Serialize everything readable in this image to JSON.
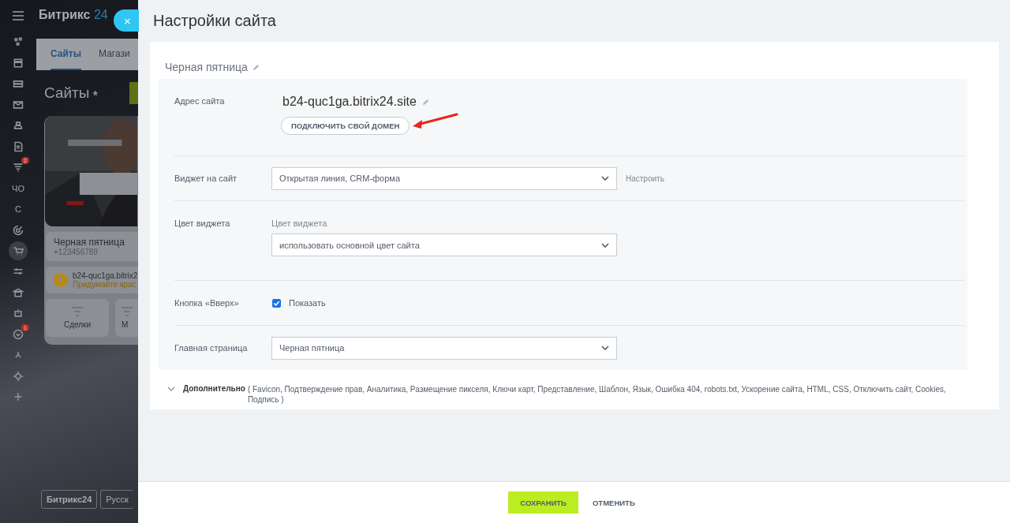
{
  "background_app": {
    "logo": {
      "name": "Битрикс",
      "accent": "24"
    },
    "nav": [
      {
        "kind": "icon"
      },
      {
        "kind": "icon"
      },
      {
        "kind": "icon"
      },
      {
        "kind": "icon"
      },
      {
        "kind": "icon"
      },
      {
        "kind": "icon"
      },
      {
        "kind": "icon",
        "badge": "2"
      },
      {
        "kind": "text",
        "label": "ЧО"
      },
      {
        "kind": "text",
        "label": "С"
      },
      {
        "kind": "icon"
      },
      {
        "kind": "icon",
        "selected": true
      },
      {
        "kind": "icon"
      },
      {
        "kind": "icon"
      },
      {
        "kind": "icon"
      },
      {
        "kind": "icon",
        "badge": "1"
      },
      {
        "kind": "icon"
      },
      {
        "kind": "icon"
      },
      {
        "kind": "icon"
      }
    ],
    "tabs": [
      {
        "label": "Сайты",
        "selected": true
      },
      {
        "label": "Магази",
        "selected": false
      }
    ],
    "heading": "Сайты",
    "site_card": {
      "name": "Черная пятница",
      "phone": "+123456789",
      "domain": "b24-quc1ga.bitrix2",
      "warning": "Придумайте крас",
      "actions": [
        "Сделки",
        "М"
      ]
    },
    "footer": {
      "logo": "Битрикс24",
      "language": "Русск"
    }
  },
  "close_button": "×",
  "panel": {
    "title": "Настройки сайта",
    "site_name": "Черная пятница",
    "rows": [
      {
        "kind": "domain",
        "label": "Адрес сайта",
        "value": "b24-quc1ga.bitrix24.site",
        "button": "ПОДКЛЮЧИТЬ СВОЙ ДОМЕН"
      },
      {
        "kind": "select",
        "label": "Виджет на сайт",
        "value": "Открытая линия, CRM-форма",
        "link": "Настроить"
      },
      {
        "kind": "select",
        "label": "Цвет виджета",
        "caption": "Цвет виджета",
        "value": "использовать основной цвет сайта"
      },
      {
        "kind": "checkbox",
        "label": "Кнопка «Вверх»",
        "option": "Показать",
        "checked": true
      },
      {
        "kind": "select",
        "label": "Главная страница",
        "value": "Черная пятница"
      }
    ],
    "more": {
      "title": "Дополнительно",
      "items": "( Favicon,  Подтверждение прав,  Аналитика,  Размещение пикселя,  Ключи карт,  Представление,  Шаблон,  Язык,  Ошибка 404,  robots.txt,  Ускорение сайта,  HTML,  CSS,  Отключить сайт,  Cookies,  Подпись )",
      "expanded": false
    }
  },
  "buttons": {
    "save": "СОХРАНИТЬ",
    "cancel": "ОТМЕНИТЬ"
  }
}
